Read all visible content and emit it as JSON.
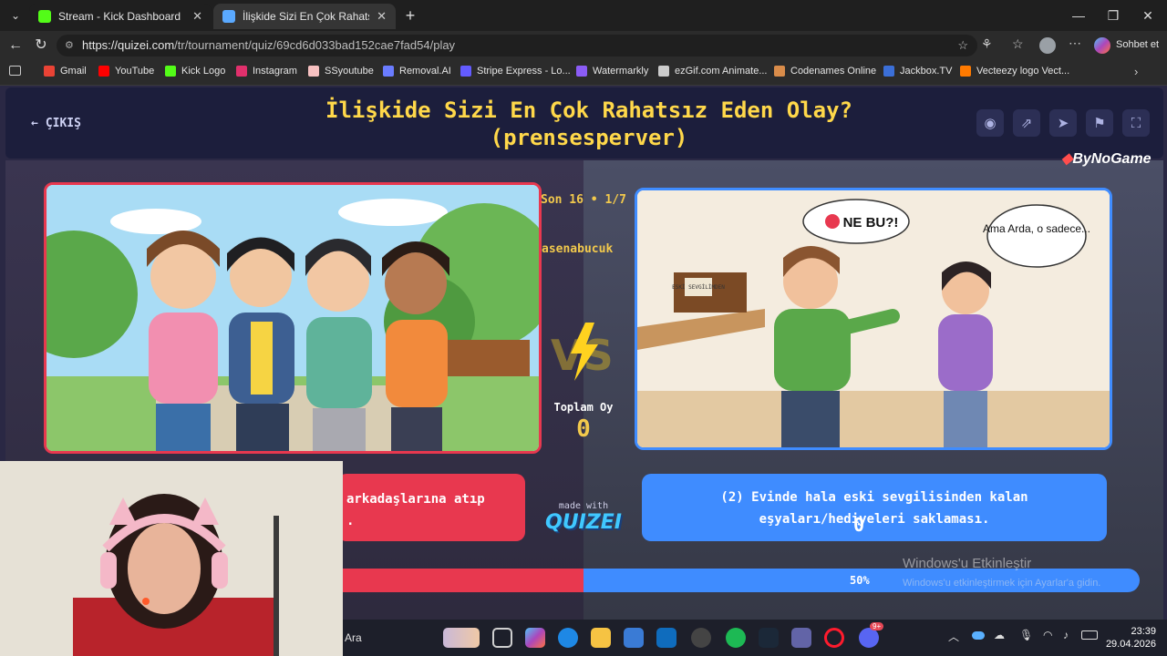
{
  "browser": {
    "tabs": [
      {
        "title": "Stream - Kick Dashboard",
        "active": false,
        "favicon_color": "#53fc18"
      },
      {
        "title": "İlişkide Sizi En Çok Rahatsız Eden O",
        "active": true,
        "favicon_color": "#5aa9ff"
      }
    ],
    "new_tab": "+",
    "url_host": "https://quizei.com",
    "url_path": "/tr/tournament/quiz/69cd6d033bad152cae7fad54/play",
    "sohbet_label": "Sohbet et",
    "bookmarks": [
      {
        "label": "Gmail",
        "color": "#ea4335"
      },
      {
        "label": "YouTube",
        "color": "#ff0000"
      },
      {
        "label": "Kick Logo",
        "color": "#53fc18"
      },
      {
        "label": "Instagram",
        "color": "#e1306c"
      },
      {
        "label": "SSyoutube",
        "color": "#f7c1c1"
      },
      {
        "label": "Removal.AI",
        "color": "#6a7cff"
      },
      {
        "label": "Stripe Express - Lo...",
        "color": "#635bff"
      },
      {
        "label": "Watermarkly",
        "color": "#8b5cf6"
      },
      {
        "label": "ezGif.com Animate...",
        "color": "#cccccc"
      },
      {
        "label": "Codenames Online",
        "color": "#d98c4a"
      },
      {
        "label": "Jackbox.TV",
        "color": "#3b6fd8"
      },
      {
        "label": "Vecteezy logo Vect...",
        "color": "#ff7a00"
      }
    ]
  },
  "quiz": {
    "exit_label": "ÇIKIŞ",
    "title_line1": "İlişkide Sizi En Çok Rahatsız Eden Olay?",
    "title_line2": "(prensesperver)",
    "brand": "ByNoGame",
    "round": "Son 16 • 1/7",
    "user": "asenabucuk",
    "total_votes_label": "Toplam Oy",
    "total_votes": "0",
    "left_option_line1": "arkadaşlarına atıp",
    "left_option_line2": ".",
    "right_option_line1": "(2) Evinde hala eski sevgilisinden kalan",
    "right_option_line2": "eşyaları/hediyeleri saklaması.",
    "right_votes": "0",
    "made_with": "made with",
    "made_with_logo": "QUIZEI",
    "bar_percent": "50%",
    "bar_fraction_right": 0.5,
    "speech1": "NE BU?!",
    "speech2": "Ama Arda, o sadece...",
    "box_label": "ESKİ SEVGİLİMDEN",
    "colors": {
      "left": "#e8384f",
      "right": "#3f8cff",
      "title": "#ffd84a"
    }
  },
  "watermark": {
    "line1": "Windows'u Etkinleştir",
    "line2": "Windows'u etkinleştirmek için Ayarlar'a gidin."
  },
  "taskbar": {
    "search": "Ara",
    "time": "23:39",
    "date": "29.04.2026",
    "discord_badge": "9+"
  }
}
